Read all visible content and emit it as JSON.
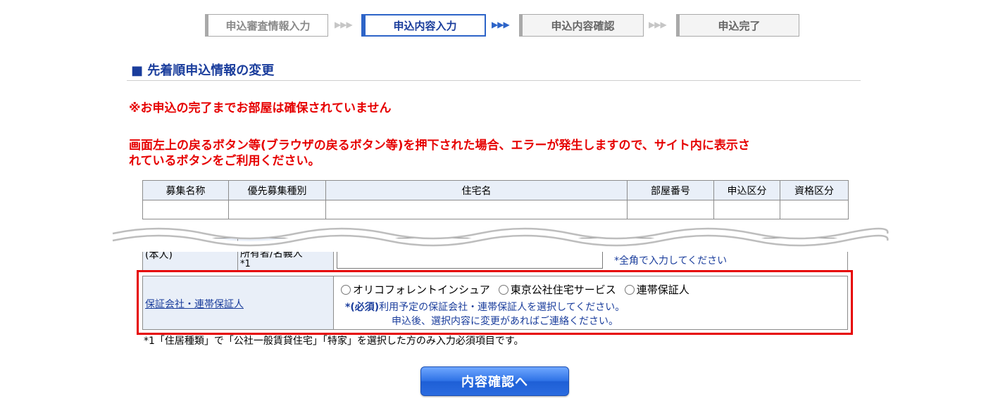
{
  "steps": [
    {
      "label": "申込審査情報入力",
      "state": "done"
    },
    {
      "label": "申込内容入力",
      "state": "active"
    },
    {
      "label": "申込内容確認",
      "state": "pending"
    },
    {
      "label": "申込完了",
      "state": "pending"
    }
  ],
  "step_arrow": "▶▶▶",
  "section": {
    "marker": "■",
    "title": "先着順申込情報の変更"
  },
  "warnings": {
    "line1": "※お申込の完了までお部屋は確保されていません",
    "line2a": "画面左上の戻るボタン等(ブラウザの戻るボタン等)を押下された場合、エラーが発生しますので、サイト内に表示さ",
    "line2b": "れているボタンをご利用ください。"
  },
  "summary_table": {
    "headers": [
      "募集名称",
      "優先募集種別",
      "住宅名",
      "部屋番号",
      "申込区分",
      "資格区分"
    ],
    "rows": [
      [
        "",
        "",
        "",
        "",
        "",
        ""
      ]
    ]
  },
  "partial_row": {
    "label_left": "(本人)",
    "label_mid": "所有者/名義人",
    "label_mid2": "*1",
    "input_value": "",
    "hint": "*全角で入力してください"
  },
  "guarantor": {
    "label": "保証会社・連帯保証人",
    "options": [
      {
        "label": "オリコフォレントインシュア",
        "selected": false
      },
      {
        "label": "東京公社住宅サービス",
        "selected": false
      },
      {
        "label": "連帯保証人",
        "selected": false
      }
    ],
    "required_mark": "*(必須)",
    "note1": "利用予定の保証会社・連帯保証人を選択してください。",
    "note2": "申込後、選択内容に変更があればご連絡ください。"
  },
  "footnote": "*1「住居種類」で「公社一般賃貸住宅」「特家」を選択した方のみ入力必須項目です。",
  "submit_label": "内容確認へ",
  "colors": {
    "accent": "#2d64c8",
    "warning": "#e60000",
    "highlight_box": "#e60000"
  }
}
